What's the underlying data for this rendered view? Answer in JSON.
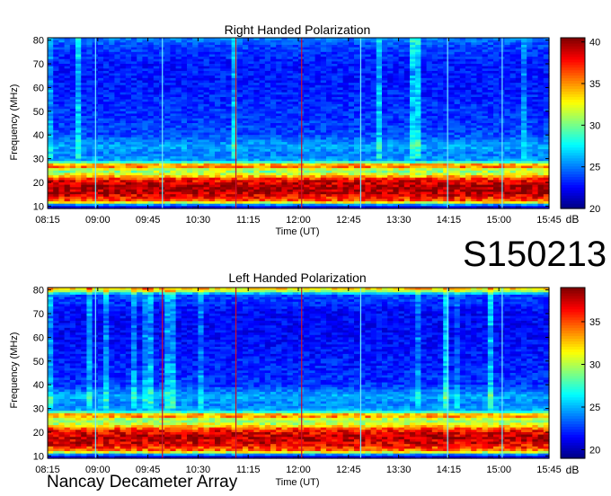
{
  "observation_id": "S150213",
  "footer": "Nancay Decameter Array",
  "chart_data": [
    {
      "type": "heatmap",
      "title": "Right Handed Polarization",
      "xlabel": "Time (UT)",
      "ylabel": "Frequency (MHz)",
      "xticks": [
        "08:15",
        "09:00",
        "09:45",
        "10:30",
        "11:15",
        "12:00",
        "12:45",
        "13:30",
        "14:15",
        "15:00",
        "15:45"
      ],
      "yticks": [
        10,
        20,
        30,
        40,
        50,
        60,
        70,
        80
      ],
      "ylim": [
        9,
        81
      ],
      "colorbar": {
        "label": "dB",
        "ticks": [
          20,
          25,
          30,
          35,
          40
        ],
        "range": [
          20,
          40.5
        ]
      },
      "intensity_profile_dB": [
        {
          "freq": 10,
          "db": 22
        },
        {
          "freq": 12,
          "db": 36
        },
        {
          "freq": 15,
          "db": 39
        },
        {
          "freq": 18,
          "db": 40
        },
        {
          "freq": 21,
          "db": 38
        },
        {
          "freq": 23,
          "db": 33
        },
        {
          "freq": 25,
          "db": 30
        },
        {
          "freq": 27,
          "db": 37
        },
        {
          "freq": 29,
          "db": 26
        },
        {
          "freq": 32,
          "db": 25
        },
        {
          "freq": 35,
          "db": 26
        },
        {
          "freq": 40,
          "db": 24
        },
        {
          "freq": 50,
          "db": 23.5
        },
        {
          "freq": 60,
          "db": 23
        },
        {
          "freq": 70,
          "db": 23
        },
        {
          "freq": 78,
          "db": 24
        },
        {
          "freq": 80,
          "db": 25
        }
      ],
      "vertical_lines": [
        {
          "time": "08:58",
          "color": "cyan"
        },
        {
          "time": "09:58",
          "color": "cyan"
        },
        {
          "time": "11:04",
          "color": "red"
        },
        {
          "time": "12:03",
          "color": "red"
        },
        {
          "time": "12:56",
          "color": "cyan"
        },
        {
          "time": "14:14",
          "color": "cyan"
        },
        {
          "time": "15:03",
          "color": "cyan"
        }
      ]
    },
    {
      "type": "heatmap",
      "title": "Left Handed Polarization",
      "xlabel": "Time (UT)",
      "ylabel": "Frequency (MHz)",
      "xticks": [
        "08:15",
        "09:00",
        "09:45",
        "10:30",
        "11:15",
        "12:00",
        "12:45",
        "13:30",
        "14:15",
        "15:00",
        "15:45"
      ],
      "yticks": [
        10,
        20,
        30,
        40,
        50,
        60,
        70,
        80
      ],
      "ylim": [
        9,
        81
      ],
      "colorbar": {
        "label": "dB",
        "ticks": [
          20,
          25,
          30,
          35
        ],
        "range": [
          19,
          39
        ]
      },
      "intensity_profile_dB": [
        {
          "freq": 10,
          "db": 21
        },
        {
          "freq": 12,
          "db": 34
        },
        {
          "freq": 15,
          "db": 37
        },
        {
          "freq": 18,
          "db": 38
        },
        {
          "freq": 21,
          "db": 36
        },
        {
          "freq": 23,
          "db": 31
        },
        {
          "freq": 25,
          "db": 29
        },
        {
          "freq": 27,
          "db": 35
        },
        {
          "freq": 29,
          "db": 25
        },
        {
          "freq": 32,
          "db": 24
        },
        {
          "freq": 35,
          "db": 25
        },
        {
          "freq": 40,
          "db": 22.5
        },
        {
          "freq": 50,
          "db": 22
        },
        {
          "freq": 60,
          "db": 21.5
        },
        {
          "freq": 70,
          "db": 21.5
        },
        {
          "freq": 78,
          "db": 23
        },
        {
          "freq": 80,
          "db": 32
        }
      ],
      "vertical_lines": [
        {
          "time": "08:58",
          "color": "cyan"
        },
        {
          "time": "09:58",
          "color": "red"
        },
        {
          "time": "11:04",
          "color": "red"
        },
        {
          "time": "12:03",
          "color": "red"
        },
        {
          "time": "12:56",
          "color": "cyan"
        },
        {
          "time": "14:14",
          "color": "cyan"
        },
        {
          "time": "15:03",
          "color": "cyan"
        }
      ]
    }
  ]
}
